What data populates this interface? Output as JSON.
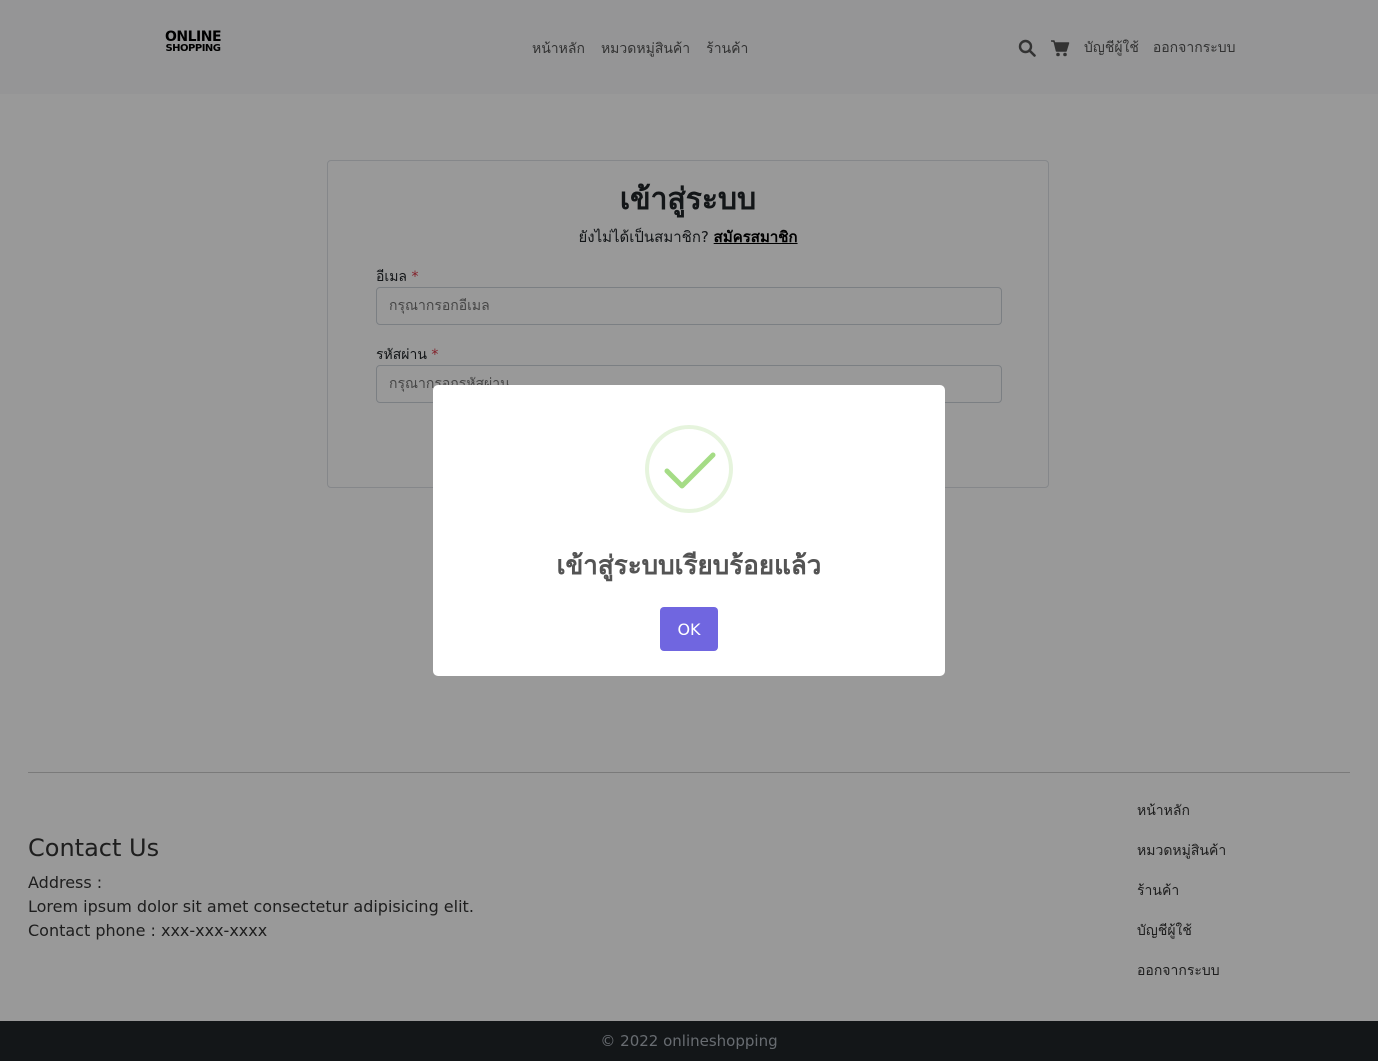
{
  "navbar": {
    "logo_line1": "ONLINE",
    "logo_line2": "SHOPPING",
    "links": [
      "หน้าหลัก",
      "หมวดหมู่สินค้า",
      "ร้านค้า"
    ],
    "account_label": "บัญชีผู้ใช้",
    "logout_label": "ออกจากระบบ",
    "search_icon": "search-icon",
    "cart_icon": "cart-icon"
  },
  "login": {
    "title": "เข้าสู่ระบบ",
    "signup_prompt": "ยังไม่ได้เป็นสมาชิก?",
    "signup_link": "สมัครสมาชิก",
    "email_label": "อีเมล",
    "email_placeholder": "กรุณากรอกอีเมล",
    "password_label": "รหัสผ่าน",
    "password_placeholder": "กรุณากรอกรหัสผ่าน",
    "required_mark": "*"
  },
  "footer": {
    "contact_title": "Contact Us",
    "address_label": "Address :",
    "address_text": "Lorem ipsum dolor sit amet consectetur adipisicing elit.",
    "phone_text": "Contact phone : xxx-xxx-xxxx",
    "links": [
      "หน้าหลัก",
      "หมวดหมู่สินค้า",
      "ร้านค้า",
      "บัญชีผู้ใช้",
      "ออกจากระบบ"
    ],
    "copyright": "© 2022 onlineshopping"
  },
  "modal": {
    "title": "เข้าสู่ระบบเรียบร้อยแล้ว",
    "ok_label": "OK",
    "icon": "success-check-icon",
    "accent_color": "#7066e0",
    "success_color": "#a5dc86"
  }
}
